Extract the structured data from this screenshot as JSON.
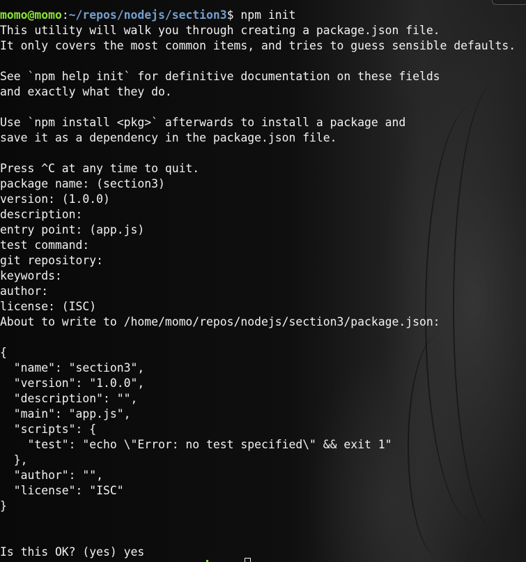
{
  "prompt": {
    "user_host": "momo@momo",
    "separator": ":",
    "path": "~/repos/nodejs/section3",
    "symbol": "$",
    "command": " npm init"
  },
  "output_lines": [
    "This utility will walk you through creating a package.json file.",
    "It only covers the most common items, and tries to guess sensible defaults.",
    "",
    "See `npm help init` for definitive documentation on these fields",
    "and exactly what they do.",
    "",
    "Use `npm install <pkg>` afterwards to install a package and",
    "save it as a dependency in the package.json file.",
    "",
    "Press ^C at any time to quit.",
    "package name: (section3)",
    "version: (1.0.0)",
    "description:",
    "entry point: (app.js)",
    "test command:",
    "git repository:",
    "keywords:",
    "author:",
    "license: (ISC)",
    "About to write to /home/momo/repos/nodejs/section3/package.json:",
    "",
    "{",
    "  \"name\": \"section3\",",
    "  \"version\": \"1.0.0\",",
    "  \"description\": \"\",",
    "  \"main\": \"app.js\",",
    "  \"scripts\": {",
    "    \"test\": \"echo \\\"Error: no test specified\\\" && exit 1\"",
    "  },",
    "  \"author\": \"\",",
    "  \"license\": \"ISC\"",
    "}",
    "",
    "",
    "Is this OK? (yes) yes"
  ],
  "colors": {
    "background": "#0d0d0d",
    "foreground": "#f2f2f2",
    "user_host": "#8ae234",
    "path": "#729fcf"
  }
}
